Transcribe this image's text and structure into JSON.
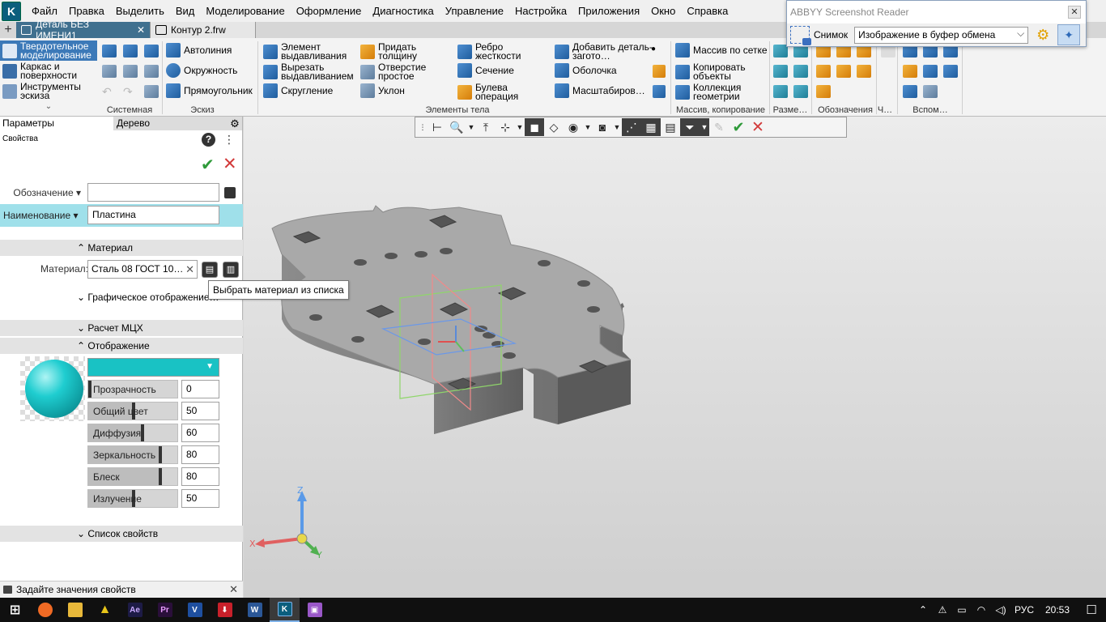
{
  "menu": [
    "Файл",
    "Правка",
    "Выделить",
    "Вид",
    "Моделирование",
    "Оформление",
    "Диагностика",
    "Управление",
    "Настройка",
    "Приложения",
    "Окно",
    "Справка"
  ],
  "tabs": [
    {
      "label": "Деталь БЕЗ ИМЕНИ1",
      "active": true
    },
    {
      "label": "Контур 2.frw",
      "active": false
    }
  ],
  "ribbon": {
    "modes": [
      "Твердотельное моделирование",
      "Каркас и поверхности",
      "Инструменты эскиза"
    ],
    "sketch": [
      "Автолиния",
      "Окружность",
      "Прямоугольник"
    ],
    "body_col1": [
      "Элемент выдавливания",
      "Вырезать выдавливанием",
      "Скругление"
    ],
    "body_col2": [
      "Придать толщину",
      "Отверстие простое",
      "Уклон"
    ],
    "body_col3": [
      "Ребро жесткости",
      "Сечение",
      "Булева операция"
    ],
    "body_col4": [
      "Добавить деталь-загото…",
      "Оболочка",
      "Масштабиров…"
    ],
    "array": [
      "Массив по сетке",
      "Копировать объекты",
      "Коллекция геометрии"
    ],
    "groups": [
      "Системная",
      "Эскиз",
      "Элементы тела",
      "Массив, копирование",
      "Разме…",
      "Обозначения",
      "Ч…",
      "Вспом…"
    ]
  },
  "abbyy": {
    "title": "ABBYY Screenshot Reader",
    "snapshot_label": "Снимок",
    "mode_value": "Изображение в буфер обмена"
  },
  "panel": {
    "tab_params": "Параметры",
    "tab_tree": "Дерево",
    "properties_label": "Свойства",
    "designation_label": "Обозначение",
    "designation_value": "",
    "name_label": "Наименование",
    "name_value": "Пластина",
    "material_section": "Материал",
    "material_label": "Материал:",
    "material_value": "Сталь 08  ГОСТ 10…",
    "tooltip": "Выбрать материал из списка",
    "graphics_section": "Графическое отображение…",
    "mass_section": "Расчет МЦХ",
    "display_section": "Отображение",
    "accent_color": "#19c2c4",
    "sliders": [
      {
        "name": "Прозрачность",
        "value": "0"
      },
      {
        "name": "Общий цвет",
        "value": "50"
      },
      {
        "name": "Диффузия",
        "value": "60"
      },
      {
        "name": "Зеркальность",
        "value": "80"
      },
      {
        "name": "Блеск",
        "value": "80"
      },
      {
        "name": "Излучение",
        "value": "50"
      }
    ],
    "props_list_section": "Список свойств"
  },
  "status": "Задайте значения свойств",
  "axes": {
    "x": "X",
    "y": "Y",
    "z": "Z"
  },
  "tray": {
    "lang": "РУС",
    "time": "20:53"
  }
}
